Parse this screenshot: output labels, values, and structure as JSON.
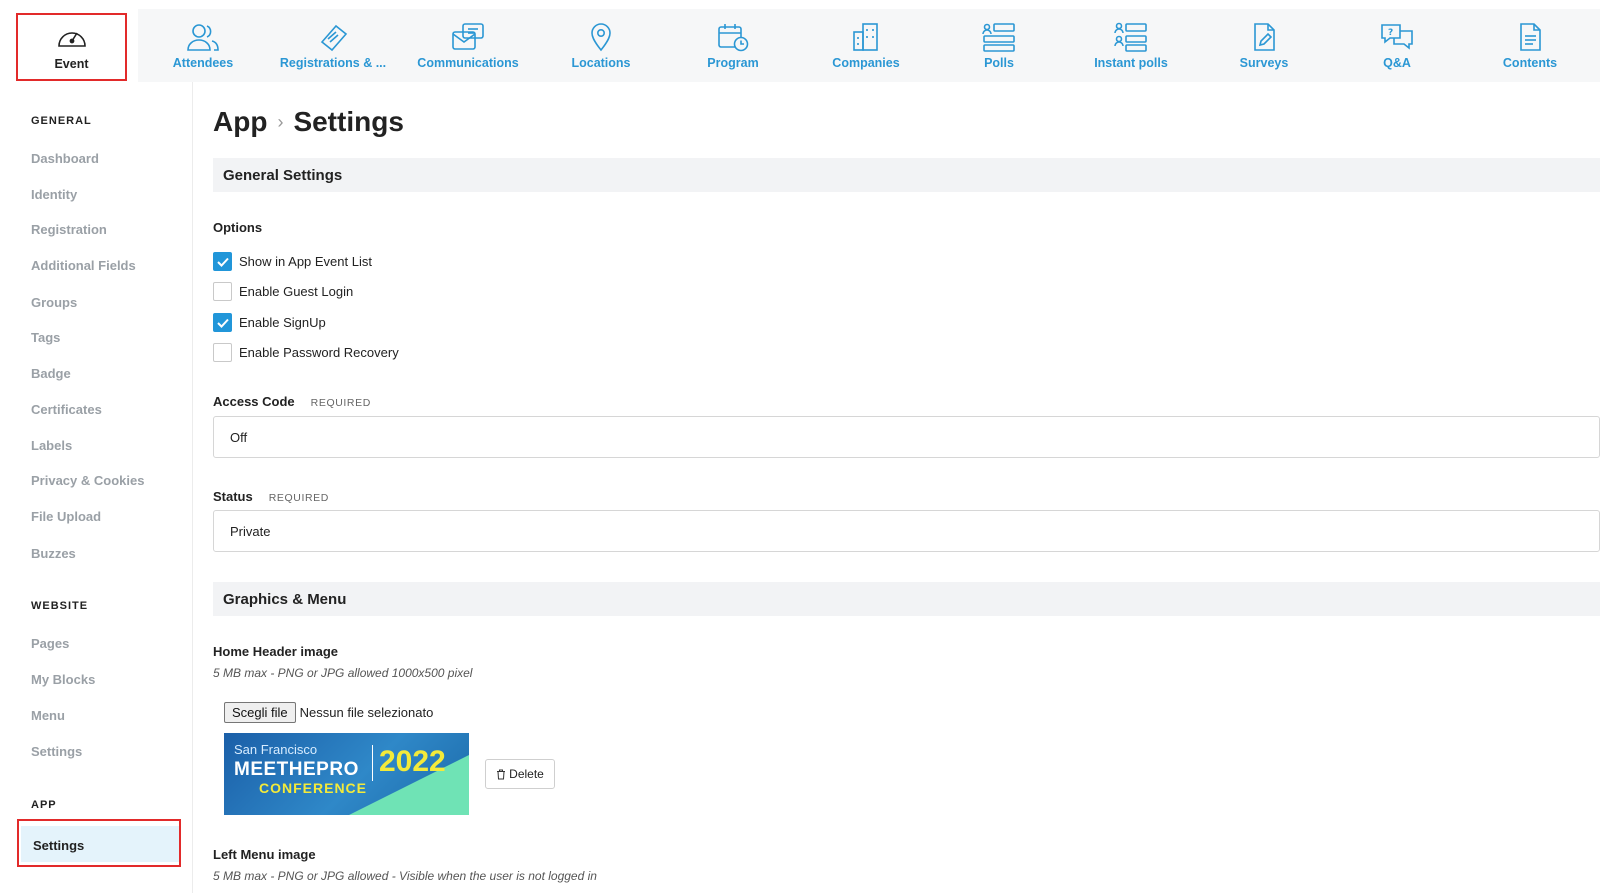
{
  "topnav": {
    "event_label": "Event",
    "items": [
      {
        "label": "Attendees",
        "icon": "attendees-icon"
      },
      {
        "label": "Registrations & ...",
        "icon": "ticket-icon"
      },
      {
        "label": "Communications",
        "icon": "communications-icon"
      },
      {
        "label": "Locations",
        "icon": "location-pin-icon"
      },
      {
        "label": "Program",
        "icon": "calendar-clock-icon"
      },
      {
        "label": "Companies",
        "icon": "buildings-icon"
      },
      {
        "label": "Polls",
        "icon": "polls-icon"
      },
      {
        "label": "Instant polls",
        "icon": "instant-polls-icon"
      },
      {
        "label": "Surveys",
        "icon": "survey-icon"
      },
      {
        "label": "Q&A",
        "icon": "qa-icon"
      },
      {
        "label": "Contents",
        "icon": "document-icon"
      }
    ],
    "accent_color": "#2b97d4",
    "highlight_color": "#e22a2a"
  },
  "sidebar": {
    "general_heading": "GENERAL",
    "general_items": [
      "Dashboard",
      "Identity",
      "Registration",
      "Additional Fields",
      "Groups",
      "Tags",
      "Badge",
      "Certificates",
      "Labels",
      "Privacy & Cookies",
      "File Upload",
      "Buzzes"
    ],
    "website_heading": "WEBSITE",
    "website_items": [
      "Pages",
      "My Blocks",
      "Menu",
      "Settings"
    ],
    "app_heading": "APP",
    "app_active": "Settings"
  },
  "main": {
    "crumb_parent": "App",
    "crumb_current": "Settings",
    "general_settings_title": "General Settings",
    "options_label": "Options",
    "options": [
      {
        "label": "Show in App Event List",
        "checked": true
      },
      {
        "label": "Enable Guest Login",
        "checked": false
      },
      {
        "label": "Enable SignUp",
        "checked": true
      },
      {
        "label": "Enable Password Recovery",
        "checked": false
      }
    ],
    "access_code_label": "Access Code",
    "access_code_required": "REQUIRED",
    "access_code_value": "Off",
    "status_label": "Status",
    "status_required": "REQUIRED",
    "status_value": "Private",
    "graphics_title": "Graphics & Menu",
    "home_header_label": "Home Header image",
    "home_header_hint": "5 MB max - PNG or JPG allowed 1000x500 pixel",
    "file_button": "Scegli file",
    "file_status": "Nessun file selezionato",
    "banner": {
      "city": "San Francisco",
      "brand": "MEETHEPRO",
      "year": "2022",
      "sub": "CONFERENCE"
    },
    "delete_label": "Delete",
    "left_menu_label": "Left Menu image",
    "left_menu_hint": "5 MB max - PNG or JPG allowed - Visible when the user is not logged in"
  }
}
